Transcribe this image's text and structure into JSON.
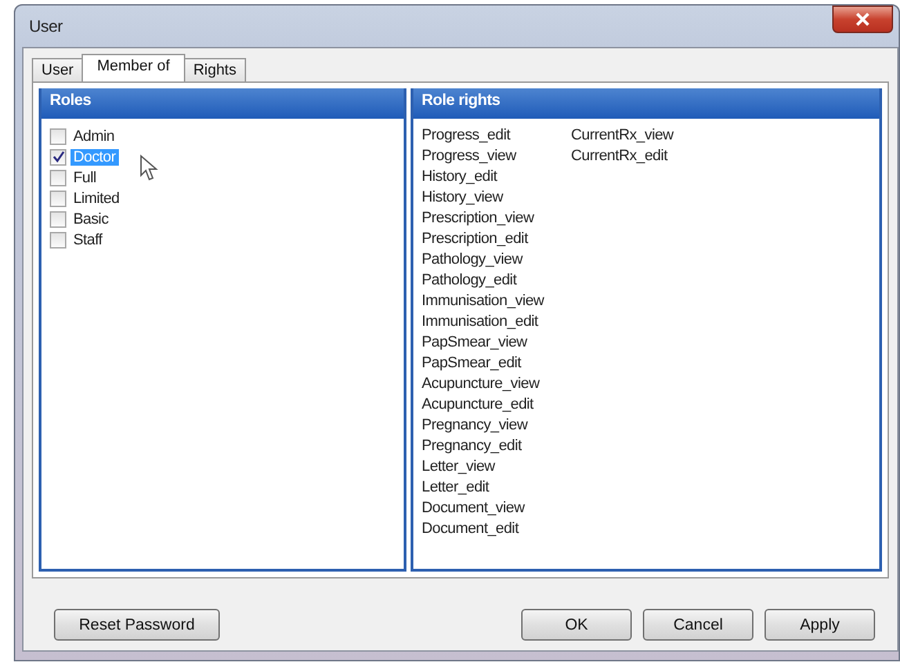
{
  "window": {
    "title": "User"
  },
  "tabs": [
    {
      "label": "User",
      "selected": false
    },
    {
      "label": "Member of",
      "selected": true
    },
    {
      "label": "Rights",
      "selected": false
    }
  ],
  "roles": {
    "title": "Roles",
    "items": [
      {
        "label": "Admin",
        "checked": false,
        "selected": false
      },
      {
        "label": "Doctor",
        "checked": true,
        "selected": true
      },
      {
        "label": "Full",
        "checked": false,
        "selected": false
      },
      {
        "label": "Limited",
        "checked": false,
        "selected": false
      },
      {
        "label": "Basic",
        "checked": false,
        "selected": false
      },
      {
        "label": "Staff",
        "checked": false,
        "selected": false
      }
    ]
  },
  "role_rights": {
    "title": "Role rights",
    "columns": [
      [
        "Progress_edit",
        "Progress_view",
        "History_edit",
        "History_view",
        "Prescription_view",
        "Prescription_edit",
        "Pathology_view",
        "Pathology_edit",
        "Immunisation_view",
        "Immunisation_edit",
        "PapSmear_view",
        "PapSmear_edit",
        "Acupuncture_view",
        "Acupuncture_edit",
        "Pregnancy_view",
        "Pregnancy_edit",
        "Letter_view",
        "Letter_edit",
        "Document_view",
        "Document_edit"
      ],
      [
        "CurrentRx_view",
        "CurrentRx_edit"
      ]
    ]
  },
  "buttons_left": [
    "Reset Password"
  ],
  "buttons_right": [
    "OK",
    "Cancel",
    "Apply"
  ]
}
